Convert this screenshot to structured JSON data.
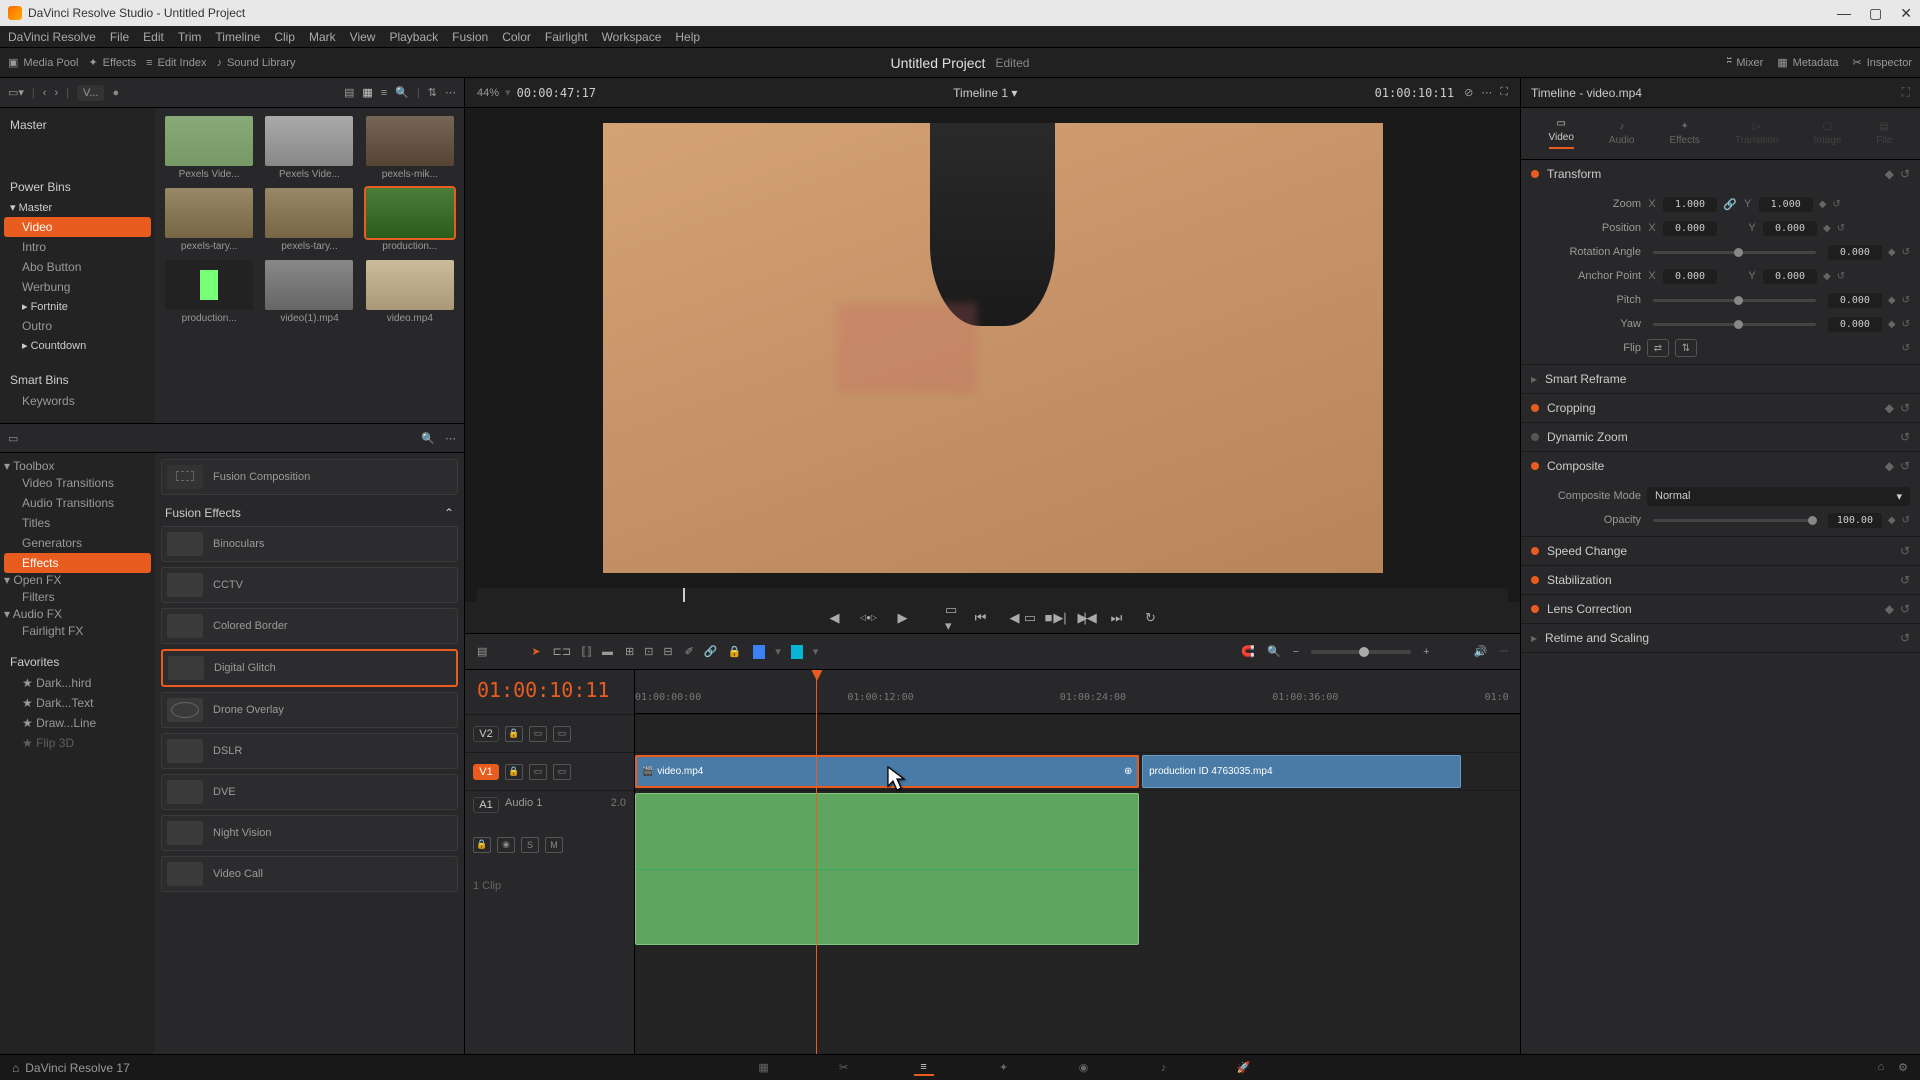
{
  "app": {
    "title": "DaVinci Resolve Studio - Untitled Project",
    "version": "DaVinci Resolve 17"
  },
  "menu": [
    "DaVinci Resolve",
    "File",
    "Edit",
    "Trim",
    "Timeline",
    "Clip",
    "Mark",
    "View",
    "Playback",
    "Fusion",
    "Color",
    "Fairlight",
    "Workspace",
    "Help"
  ],
  "toolbar": {
    "mediaPool": "Media Pool",
    "effects": "Effects",
    "editIndex": "Edit Index",
    "soundLib": "Sound Library",
    "project": "Untitled Project",
    "edited": "Edited",
    "mixer": "Mixer",
    "metadata": "Metadata",
    "inspector": "Inspector"
  },
  "mediaHeader": {
    "viewLabel": "V...",
    "zoom": "44%",
    "sourceTC": "00:00:47:17"
  },
  "bins": {
    "root": "Master",
    "power": "Power Bins",
    "powerItems": [
      "Master",
      "Video",
      "Intro",
      "Abo Button",
      "Werbung",
      "Fortnite",
      "Outro",
      "Countdown"
    ],
    "smart": "Smart Bins",
    "smartItems": [
      "Keywords"
    ]
  },
  "thumbs": [
    {
      "label": "Pexels Vide..."
    },
    {
      "label": "Pexels Vide..."
    },
    {
      "label": "pexels-mik..."
    },
    {
      "label": "pexels-tary..."
    },
    {
      "label": "pexels-tary..."
    },
    {
      "label": "production..."
    },
    {
      "label": "production..."
    },
    {
      "label": "video(1).mp4"
    },
    {
      "label": "video.mp4"
    }
  ],
  "fxTree": {
    "toolbox": "Toolbox",
    "items": [
      "Video Transitions",
      "Audio Transitions",
      "Titles",
      "Generators",
      "Effects"
    ],
    "openfx": "Open FX",
    "openfxItems": [
      "Filters"
    ],
    "audiofx": "Audio FX",
    "audiofxItems": [
      "Fairlight FX"
    ],
    "favs": "Favorites",
    "favItems": [
      "Dark...hird",
      "Dark...Text",
      "Draw...Line",
      "Flip 3D"
    ]
  },
  "fxList": {
    "fusionComp": "Fusion Composition",
    "groupTitle": "Fusion Effects",
    "items": [
      "Binoculars",
      "CCTV",
      "Colored Border",
      "Digital Glitch",
      "Drone Overlay",
      "DSLR",
      "DVE",
      "Night Vision",
      "Video Call"
    ]
  },
  "viewer": {
    "title": "Timeline 1",
    "rightTC": "01:00:10:11"
  },
  "timeline": {
    "tc": "01:00:10:11",
    "ruler": [
      "01:00:00:00",
      "01:00:12:00",
      "01:00:24:00",
      "01:00:36:00",
      "01:0"
    ],
    "tracks": {
      "v2": "V2",
      "v1": "V1",
      "a1": "A1",
      "audioName": "Audio 1",
      "audioCh": "2.0",
      "clipCount": "1 Clip",
      "s": "S",
      "m": "M"
    },
    "clips": {
      "vid1": "video.mp4",
      "vid2": "production ID 4763035.mp4"
    }
  },
  "inspector": {
    "title": "Timeline - video.mp4",
    "tabs": [
      "Video",
      "Audio",
      "Effects",
      "Transition",
      "Image",
      "File"
    ],
    "transform": {
      "title": "Transform",
      "zoom": "Zoom",
      "zx": "1.000",
      "zy": "1.000",
      "pos": "Position",
      "px": "0.000",
      "py": "0.000",
      "rot": "Rotation Angle",
      "rv": "0.000",
      "anchor": "Anchor Point",
      "ax": "0.000",
      "ay": "0.000",
      "pitch": "Pitch",
      "pv": "0.000",
      "yaw": "Yaw",
      "yv": "0.000",
      "flip": "Flip"
    },
    "sections": [
      "Smart Reframe",
      "Cropping",
      "Dynamic Zoom",
      "Composite",
      "Speed Change",
      "Stabilization",
      "Lens Correction",
      "Retime and Scaling"
    ],
    "composite": {
      "mode": "Composite Mode",
      "modeVal": "Normal",
      "opacity": "Opacity",
      "opVal": "100.00"
    }
  }
}
